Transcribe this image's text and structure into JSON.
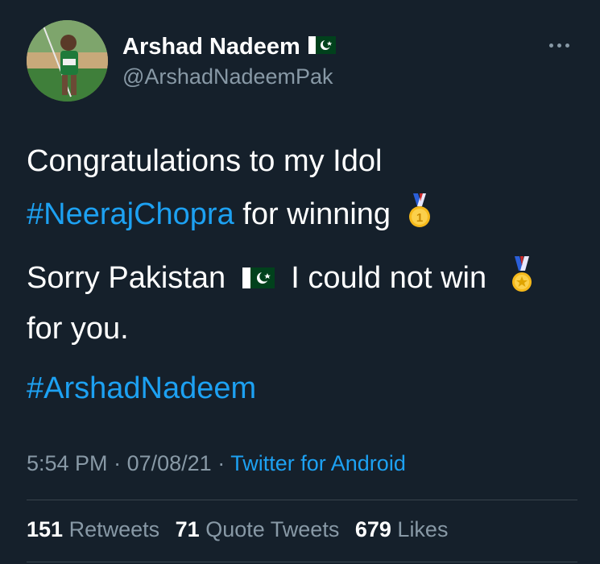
{
  "user": {
    "name": "Arshad Nadeem",
    "handle": "@ArshadNadeemPak",
    "flag_icon": "pakistan-flag-icon"
  },
  "more_icon": "more-options-icon",
  "tweet": {
    "line1": "Congratulations to my Idol",
    "line2_hashtag": "#NeerajChopra",
    "line2_text": "for winning",
    "line3_part1": "Sorry Pakistan",
    "line3_part2": "I could not win",
    "line4": "for you.",
    "line5_hashtag": "#ArshadNadeem",
    "emoji1": "gold-medal-1st-icon",
    "emoji2": "medal-icon"
  },
  "meta": {
    "time": "5:54 PM",
    "sep1": "·",
    "date": "07/08/21",
    "sep2": "·",
    "app": "Twitter for Android"
  },
  "stats": {
    "retweets_count": "151",
    "retweets_label": "Retweets",
    "quotes_count": "71",
    "quotes_label": "Quote Tweets",
    "likes_count": "679",
    "likes_label": "Likes"
  },
  "colors": {
    "background": "#15202b",
    "link": "#1da1f2",
    "secondary": "#8899a6",
    "divider": "#38444d"
  }
}
